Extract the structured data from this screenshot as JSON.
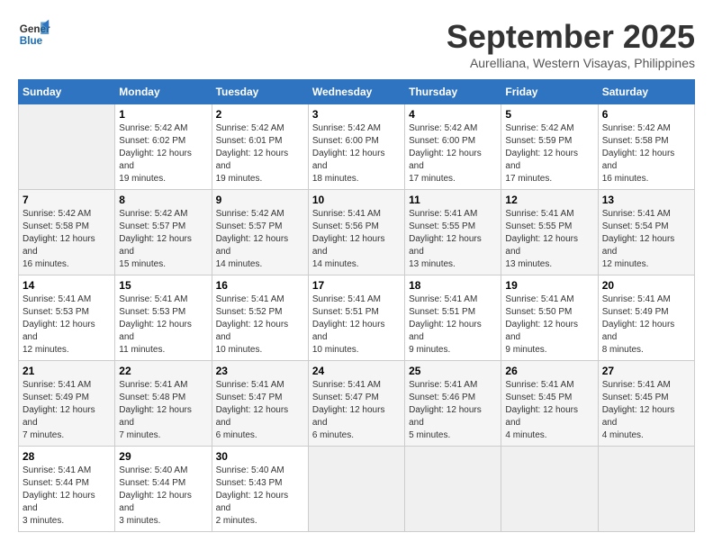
{
  "header": {
    "logo_line1": "General",
    "logo_line2": "Blue",
    "month": "September 2025",
    "location": "Aurelliana, Western Visayas, Philippines"
  },
  "days_of_week": [
    "Sunday",
    "Monday",
    "Tuesday",
    "Wednesday",
    "Thursday",
    "Friday",
    "Saturday"
  ],
  "weeks": [
    [
      {
        "day": "",
        "empty": true
      },
      {
        "day": "1",
        "sunrise": "Sunrise: 5:42 AM",
        "sunset": "Sunset: 6:02 PM",
        "daylight": "Daylight: 12 hours and 19 minutes."
      },
      {
        "day": "2",
        "sunrise": "Sunrise: 5:42 AM",
        "sunset": "Sunset: 6:01 PM",
        "daylight": "Daylight: 12 hours and 19 minutes."
      },
      {
        "day": "3",
        "sunrise": "Sunrise: 5:42 AM",
        "sunset": "Sunset: 6:00 PM",
        "daylight": "Daylight: 12 hours and 18 minutes."
      },
      {
        "day": "4",
        "sunrise": "Sunrise: 5:42 AM",
        "sunset": "Sunset: 6:00 PM",
        "daylight": "Daylight: 12 hours and 17 minutes."
      },
      {
        "day": "5",
        "sunrise": "Sunrise: 5:42 AM",
        "sunset": "Sunset: 5:59 PM",
        "daylight": "Daylight: 12 hours and 17 minutes."
      },
      {
        "day": "6",
        "sunrise": "Sunrise: 5:42 AM",
        "sunset": "Sunset: 5:58 PM",
        "daylight": "Daylight: 12 hours and 16 minutes."
      }
    ],
    [
      {
        "day": "7",
        "sunrise": "Sunrise: 5:42 AM",
        "sunset": "Sunset: 5:58 PM",
        "daylight": "Daylight: 12 hours and 16 minutes."
      },
      {
        "day": "8",
        "sunrise": "Sunrise: 5:42 AM",
        "sunset": "Sunset: 5:57 PM",
        "daylight": "Daylight: 12 hours and 15 minutes."
      },
      {
        "day": "9",
        "sunrise": "Sunrise: 5:42 AM",
        "sunset": "Sunset: 5:57 PM",
        "daylight": "Daylight: 12 hours and 14 minutes."
      },
      {
        "day": "10",
        "sunrise": "Sunrise: 5:41 AM",
        "sunset": "Sunset: 5:56 PM",
        "daylight": "Daylight: 12 hours and 14 minutes."
      },
      {
        "day": "11",
        "sunrise": "Sunrise: 5:41 AM",
        "sunset": "Sunset: 5:55 PM",
        "daylight": "Daylight: 12 hours and 13 minutes."
      },
      {
        "day": "12",
        "sunrise": "Sunrise: 5:41 AM",
        "sunset": "Sunset: 5:55 PM",
        "daylight": "Daylight: 12 hours and 13 minutes."
      },
      {
        "day": "13",
        "sunrise": "Sunrise: 5:41 AM",
        "sunset": "Sunset: 5:54 PM",
        "daylight": "Daylight: 12 hours and 12 minutes."
      }
    ],
    [
      {
        "day": "14",
        "sunrise": "Sunrise: 5:41 AM",
        "sunset": "Sunset: 5:53 PM",
        "daylight": "Daylight: 12 hours and 12 minutes."
      },
      {
        "day": "15",
        "sunrise": "Sunrise: 5:41 AM",
        "sunset": "Sunset: 5:53 PM",
        "daylight": "Daylight: 12 hours and 11 minutes."
      },
      {
        "day": "16",
        "sunrise": "Sunrise: 5:41 AM",
        "sunset": "Sunset: 5:52 PM",
        "daylight": "Daylight: 12 hours and 10 minutes."
      },
      {
        "day": "17",
        "sunrise": "Sunrise: 5:41 AM",
        "sunset": "Sunset: 5:51 PM",
        "daylight": "Daylight: 12 hours and 10 minutes."
      },
      {
        "day": "18",
        "sunrise": "Sunrise: 5:41 AM",
        "sunset": "Sunset: 5:51 PM",
        "daylight": "Daylight: 12 hours and 9 minutes."
      },
      {
        "day": "19",
        "sunrise": "Sunrise: 5:41 AM",
        "sunset": "Sunset: 5:50 PM",
        "daylight": "Daylight: 12 hours and 9 minutes."
      },
      {
        "day": "20",
        "sunrise": "Sunrise: 5:41 AM",
        "sunset": "Sunset: 5:49 PM",
        "daylight": "Daylight: 12 hours and 8 minutes."
      }
    ],
    [
      {
        "day": "21",
        "sunrise": "Sunrise: 5:41 AM",
        "sunset": "Sunset: 5:49 PM",
        "daylight": "Daylight: 12 hours and 7 minutes."
      },
      {
        "day": "22",
        "sunrise": "Sunrise: 5:41 AM",
        "sunset": "Sunset: 5:48 PM",
        "daylight": "Daylight: 12 hours and 7 minutes."
      },
      {
        "day": "23",
        "sunrise": "Sunrise: 5:41 AM",
        "sunset": "Sunset: 5:47 PM",
        "daylight": "Daylight: 12 hours and 6 minutes."
      },
      {
        "day": "24",
        "sunrise": "Sunrise: 5:41 AM",
        "sunset": "Sunset: 5:47 PM",
        "daylight": "Daylight: 12 hours and 6 minutes."
      },
      {
        "day": "25",
        "sunrise": "Sunrise: 5:41 AM",
        "sunset": "Sunset: 5:46 PM",
        "daylight": "Daylight: 12 hours and 5 minutes."
      },
      {
        "day": "26",
        "sunrise": "Sunrise: 5:41 AM",
        "sunset": "Sunset: 5:45 PM",
        "daylight": "Daylight: 12 hours and 4 minutes."
      },
      {
        "day": "27",
        "sunrise": "Sunrise: 5:41 AM",
        "sunset": "Sunset: 5:45 PM",
        "daylight": "Daylight: 12 hours and 4 minutes."
      }
    ],
    [
      {
        "day": "28",
        "sunrise": "Sunrise: 5:41 AM",
        "sunset": "Sunset: 5:44 PM",
        "daylight": "Daylight: 12 hours and 3 minutes."
      },
      {
        "day": "29",
        "sunrise": "Sunrise: 5:40 AM",
        "sunset": "Sunset: 5:44 PM",
        "daylight": "Daylight: 12 hours and 3 minutes."
      },
      {
        "day": "30",
        "sunrise": "Sunrise: 5:40 AM",
        "sunset": "Sunset: 5:43 PM",
        "daylight": "Daylight: 12 hours and 2 minutes."
      },
      {
        "day": "",
        "empty": true
      },
      {
        "day": "",
        "empty": true
      },
      {
        "day": "",
        "empty": true
      },
      {
        "day": "",
        "empty": true
      }
    ]
  ]
}
